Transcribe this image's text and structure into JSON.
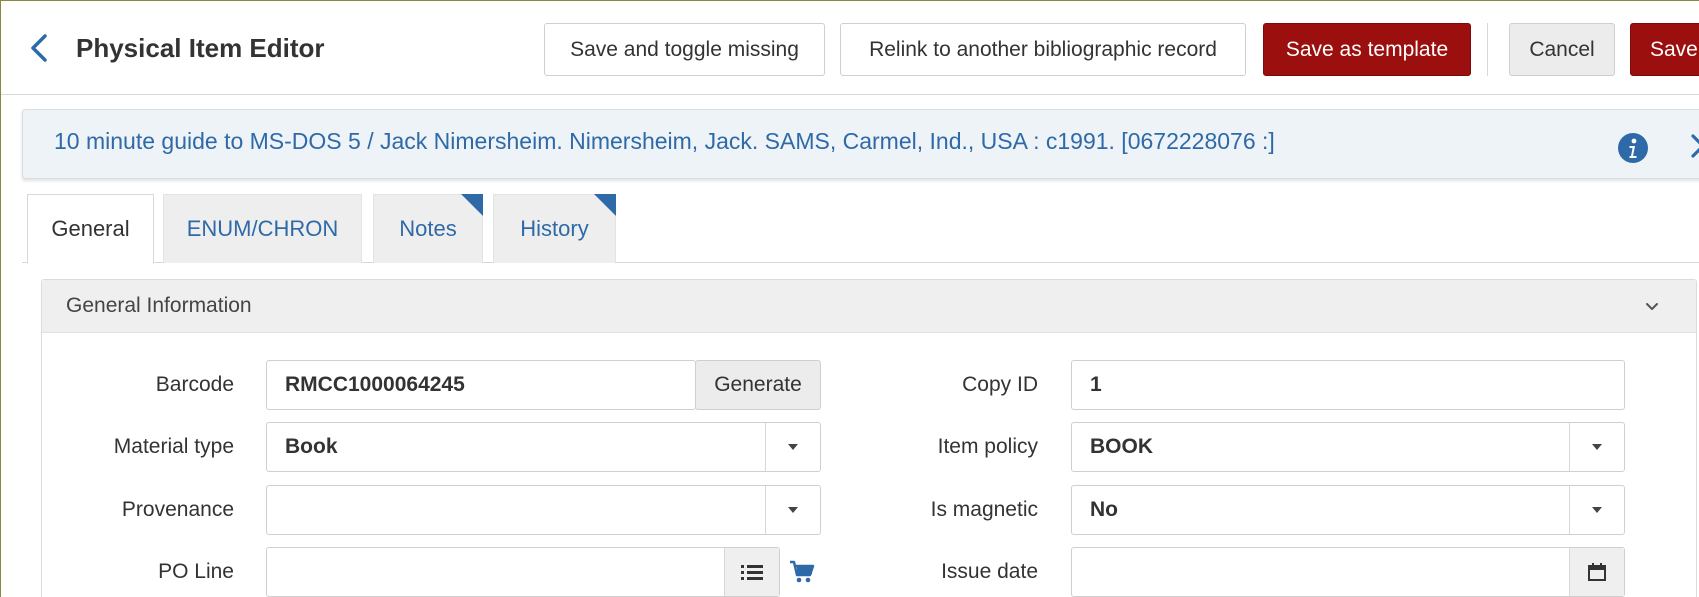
{
  "header": {
    "title": "Physical Item Editor",
    "buttons": {
      "toggle_missing": "Save and toggle missing",
      "relink": "Relink to another bibliographic record",
      "save_template": "Save as template",
      "cancel": "Cancel",
      "save": "Save"
    }
  },
  "record": {
    "text": "10 minute guide to MS-DOS 5 / Jack Nimersheim. Nimersheim, Jack. SAMS, Carmel, Ind., USA : c1991. [0672228076 :]"
  },
  "tabs": [
    {
      "label": "General",
      "active": true
    },
    {
      "label": "ENUM/CHRON",
      "active": false
    },
    {
      "label": "Notes",
      "active": false,
      "has_content": true
    },
    {
      "label": "History",
      "active": false,
      "has_content": true
    }
  ],
  "section": {
    "title": "General Information"
  },
  "form": {
    "barcode": {
      "label": "Barcode",
      "value": "RMCC1000064245",
      "generate_label": "Generate"
    },
    "copy_id": {
      "label": "Copy ID",
      "value": "1"
    },
    "material_type": {
      "label": "Material type",
      "value": "Book"
    },
    "item_policy": {
      "label": "Item policy",
      "value": "BOOK"
    },
    "provenance": {
      "label": "Provenance",
      "value": ""
    },
    "is_magnetic": {
      "label": "Is magnetic",
      "value": "No"
    },
    "po_line": {
      "label": "PO Line",
      "value": ""
    },
    "issue_date": {
      "label": "Issue date",
      "value": ""
    }
  },
  "colors": {
    "primary_red": "#9c0f0f",
    "link_blue": "#2f6aa8",
    "tab_corner_blue": "#2f6aa8"
  },
  "icons": {
    "back": "chevron-left-icon",
    "info": "info-circle-icon",
    "next": "chevron-right-icon",
    "collapse": "chevron-down-icon",
    "dropdown": "caret-down-icon",
    "list": "list-icon",
    "cart": "shopping-cart-icon",
    "calendar": "calendar-icon"
  }
}
